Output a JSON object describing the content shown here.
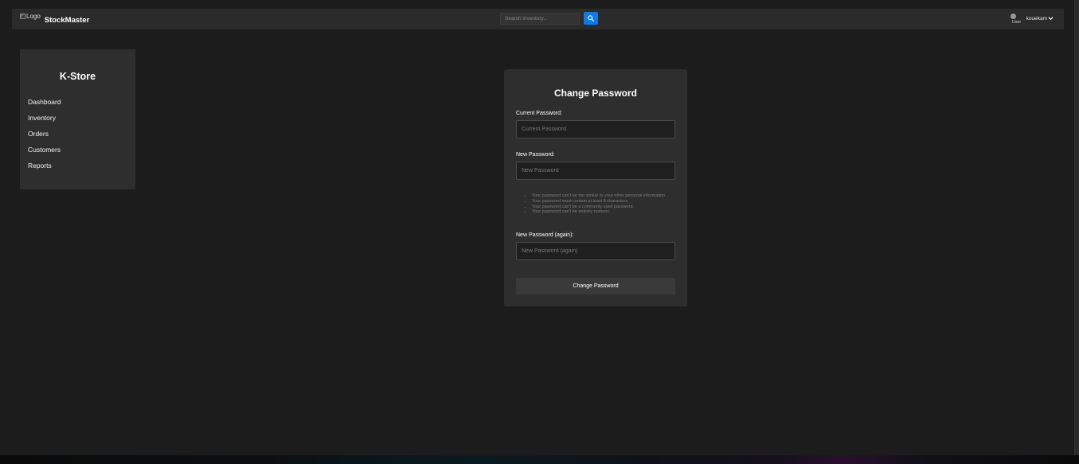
{
  "navbar": {
    "logo_alt": "Logo",
    "brand": "StockMaster",
    "search_placeholder": "Search inventory...",
    "search_icon": "search-icon",
    "user_alt": "User",
    "username": "kouekam",
    "caret_icon": "chevron-down-icon"
  },
  "sidebar": {
    "title": "K-Store",
    "items": [
      {
        "label": "Dashboard"
      },
      {
        "label": "Inventory"
      },
      {
        "label": "Orders"
      },
      {
        "label": "Customers"
      },
      {
        "label": "Reports"
      }
    ]
  },
  "form": {
    "title": "Change Password",
    "current_label": "Current Password:",
    "current_placeholder": "Current Password",
    "new_label": "New Password:",
    "new_placeholder": "New Password",
    "help": [
      "Your password can't be too similar to your other personal information.",
      "Your password must contain at least 8 characters.",
      "Your password can't be a commonly used password.",
      "Your password can't be entirely numeric."
    ],
    "confirm_label": "New Password (again):",
    "confirm_placeholder": "New Password (again)",
    "submit_label": "Change Password"
  },
  "colors": {
    "background": "#1c1c1c",
    "panel": "#2e2e2e",
    "accent": "#0d7ae6"
  }
}
